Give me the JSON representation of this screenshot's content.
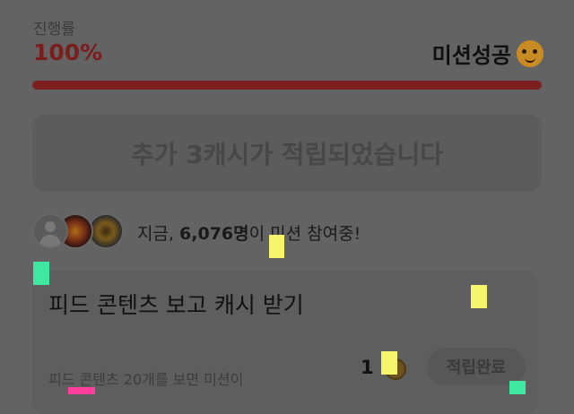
{
  "progress": {
    "label": "진행률",
    "value_text": "100%",
    "fraction": 1.0,
    "status_text": "미션성공",
    "accent_color": "#7d1f1f"
  },
  "banner": {
    "text": "추가 3캐시가 적립되었습니다"
  },
  "participants": {
    "prefix": "지금, ",
    "count": "6,076명",
    "suffix": "이 미션 참여중!"
  },
  "mission": {
    "title": "피드 콘텐츠 보고 캐시 받기",
    "description": "피드 콘텐츠 20개를 보면 미션이",
    "reward_amount": "1",
    "reward_icon": "coin-icon",
    "button_label": "적립완료"
  },
  "markers": [
    {
      "color": "#f5f56b"
    },
    {
      "color": "#3fe8a0"
    },
    {
      "color": "#f5f56b"
    },
    {
      "color": "#f5f56b"
    },
    {
      "color": "#3fe8a0"
    },
    {
      "color": "#ff3d9a"
    }
  ]
}
